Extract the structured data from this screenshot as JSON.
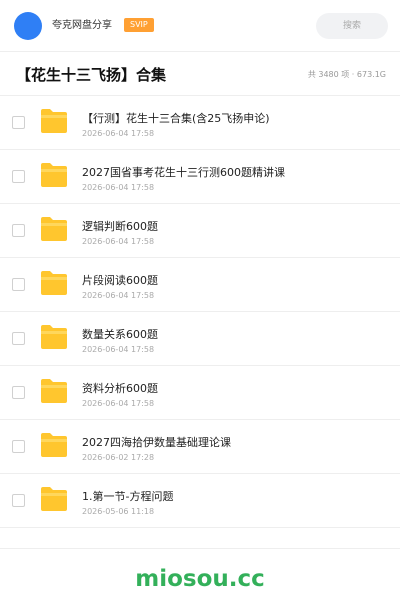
{
  "header": {
    "app_name": "夸克网盘分享",
    "badge": "SVIP",
    "search_placeholder": "搜索"
  },
  "folder": {
    "title": "【花生十三飞扬】合集",
    "meta": "共 3480 项 · 673.1G"
  },
  "items": [
    {
      "name": "【行测】花生十三合集(含25飞扬申论)",
      "date": "2026-06-04 17:58",
      "icon": "folder-icon"
    },
    {
      "name": "2027国省事考花生十三行测600题精讲课",
      "date": "2026-06-04 17:58",
      "icon": "folder-icon"
    },
    {
      "name": "逻辑判断600题",
      "date": "2026-06-04 17:58",
      "icon": "folder-icon"
    },
    {
      "name": "片段阅读600题",
      "date": "2026-06-04 17:58",
      "icon": "folder-icon"
    },
    {
      "name": "数量关系600题",
      "date": "2026-06-04 17:58",
      "icon": "folder-icon"
    },
    {
      "name": "资料分析600题",
      "date": "2026-06-04 17:58",
      "icon": "folder-icon"
    },
    {
      "name": "2027四海拾伊数量基础理论课",
      "date": "2026-06-02 17:28",
      "icon": "folder-icon"
    },
    {
      "name": "1.第一节-方程问题",
      "date": "2026-05-06 11:18",
      "icon": "folder-icon"
    }
  ],
  "watermark": "miosou.cc",
  "colors": {
    "accent": "#2f7ff5",
    "badge": "#ffa033",
    "folder": "#ffc62e",
    "watermark": "#33b05a"
  }
}
